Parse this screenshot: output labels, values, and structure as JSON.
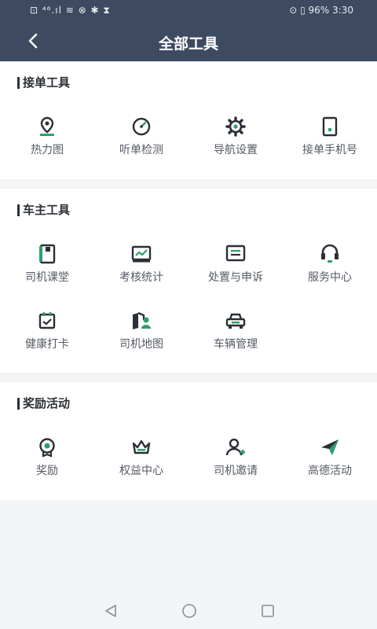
{
  "status_bar": {
    "left": "⊡ ⁴⁶.ıl ≋ ⊗ ✱ ⧗",
    "battery": "⊙ ▯ 96%",
    "time": "3:30"
  },
  "header": {
    "title": "全部工具"
  },
  "sections": [
    {
      "title": "接单工具",
      "items": [
        {
          "label": "热力图",
          "icon": "heatmap-pin-icon"
        },
        {
          "label": "听单检测",
          "icon": "speedometer-icon"
        },
        {
          "label": "导航设置",
          "icon": "gear-icon"
        },
        {
          "label": "接单手机号",
          "icon": "phone-icon"
        }
      ]
    },
    {
      "title": "车主工具",
      "items": [
        {
          "label": "司机课堂",
          "icon": "notebook-icon"
        },
        {
          "label": "考核统计",
          "icon": "chart-icon"
        },
        {
          "label": "处置与申诉",
          "icon": "message-icon"
        },
        {
          "label": "服务中心",
          "icon": "headset-icon"
        },
        {
          "label": "健康打卡",
          "icon": "calendar-check-icon"
        },
        {
          "label": "司机地图",
          "icon": "map-driver-icon"
        },
        {
          "label": "车辆管理",
          "icon": "car-icon"
        }
      ]
    },
    {
      "title": "奖励活动",
      "items": [
        {
          "label": "奖励",
          "icon": "medal-icon"
        },
        {
          "label": "权益中心",
          "icon": "crown-icon"
        },
        {
          "label": "司机邀请",
          "icon": "add-user-icon"
        },
        {
          "label": "高德活动",
          "icon": "paper-plane-icon"
        }
      ]
    }
  ],
  "colors": {
    "header_bg": "#3e4a60",
    "accent_green": "#2e9e6e",
    "icon_dark": "#2b2f36"
  }
}
